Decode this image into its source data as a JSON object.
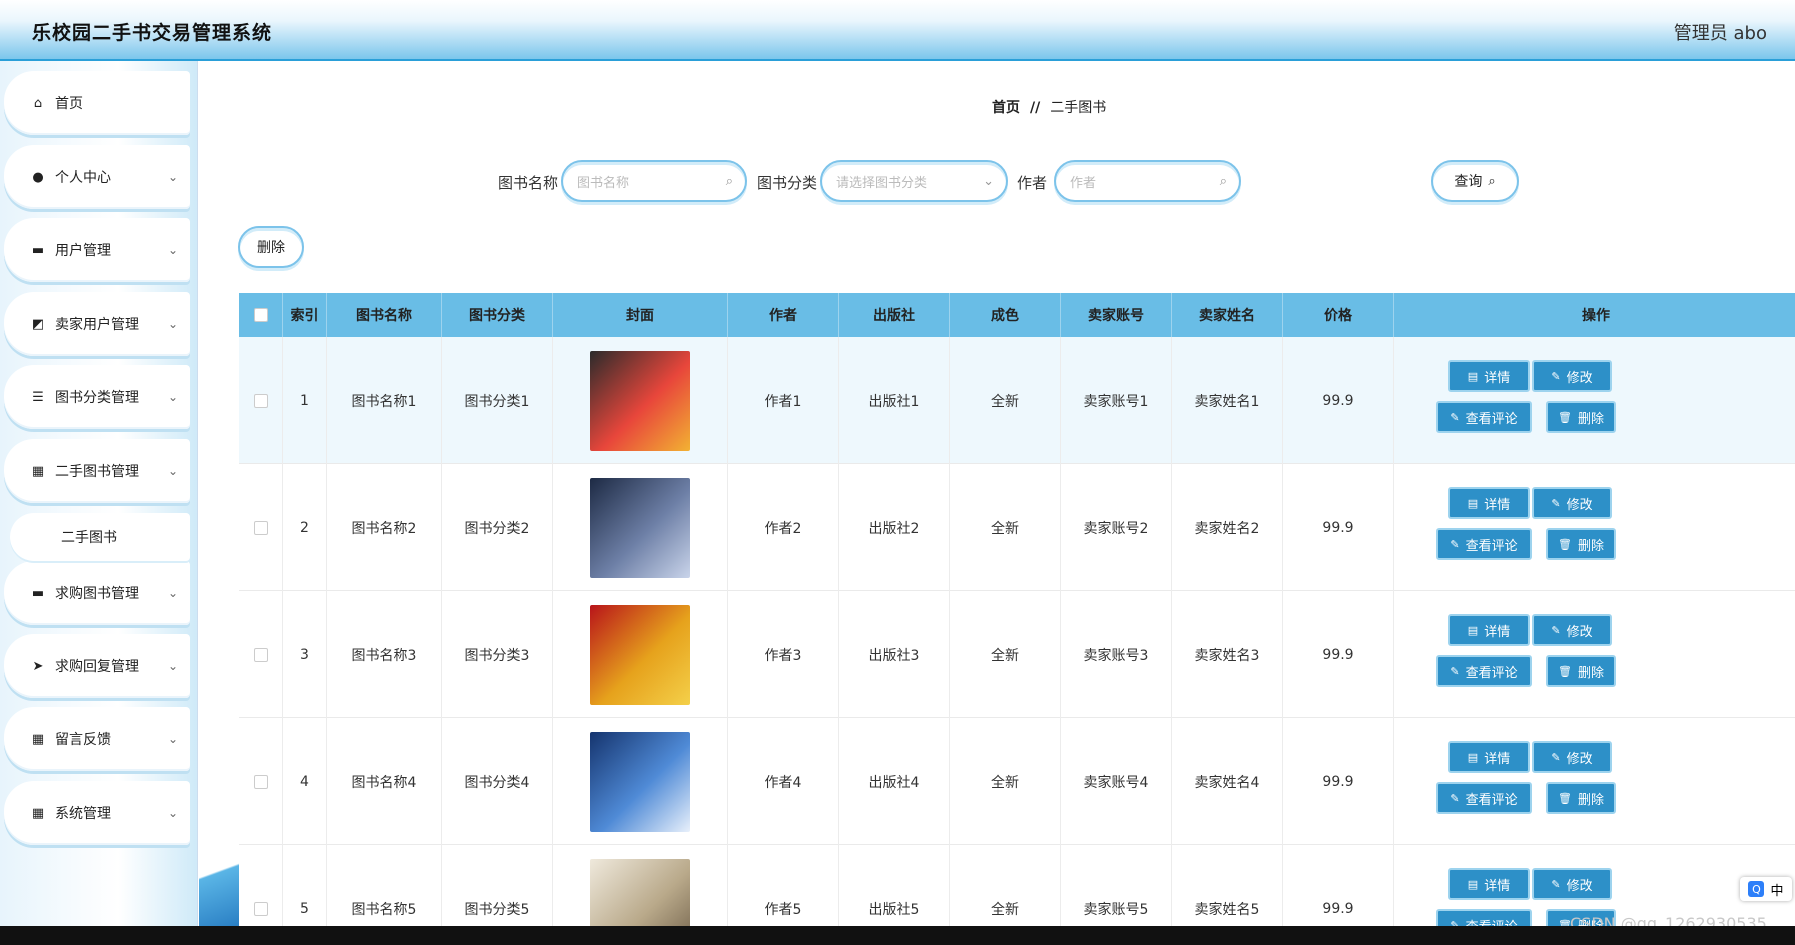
{
  "header": {
    "title": "乐校园二手书交易管理系统",
    "admin": "管理员 abo"
  },
  "sidebar": {
    "items": [
      {
        "label": "首页",
        "icon": "home-icon",
        "glyph": "⌂",
        "has_children": false
      },
      {
        "label": "个人中心",
        "icon": "user-icon",
        "glyph": "●",
        "has_children": true
      },
      {
        "label": "用户管理",
        "icon": "monitor-icon",
        "glyph": "▬",
        "has_children": true
      },
      {
        "label": "卖家用户管理",
        "icon": "chart-icon",
        "glyph": "◩",
        "has_children": true
      },
      {
        "label": "图书分类管理",
        "icon": "list-icon",
        "glyph": "☰",
        "has_children": true
      },
      {
        "label": "二手图书管理",
        "icon": "grid-icon",
        "glyph": "▦",
        "has_children": true
      },
      {
        "label": "求购图书管理",
        "icon": "book-icon",
        "glyph": "▬",
        "has_children": true
      },
      {
        "label": "求购回复管理",
        "icon": "send-icon",
        "glyph": "➤",
        "has_children": true
      },
      {
        "label": "留言反馈",
        "icon": "grid-icon",
        "glyph": "▦",
        "has_children": true
      },
      {
        "label": "系统管理",
        "icon": "grid-icon",
        "glyph": "▦",
        "has_children": true
      }
    ],
    "submenu": {
      "label": "二手图书"
    }
  },
  "breadcrumb": {
    "home": "首页",
    "sep": "//",
    "current": "二手图书"
  },
  "search": {
    "name_label": "图书名称",
    "name_placeholder": "图书名称",
    "category_label": "图书分类",
    "category_placeholder": "请选择图书分类",
    "author_label": "作者",
    "author_placeholder": "作者",
    "query_label": "查询"
  },
  "toolbar": {
    "delete_label": "删除"
  },
  "table": {
    "headers": [
      "索引",
      "图书名称",
      "图书分类",
      "封面",
      "作者",
      "出版社",
      "成色",
      "卖家账号",
      "卖家姓名",
      "价格",
      "操作"
    ],
    "actions": {
      "detail": "详情",
      "edit": "修改",
      "comments": "查看评论",
      "delete": "删除"
    },
    "rows": [
      {
        "index": "1",
        "name": "图书名称1",
        "category": "图书分类1",
        "author": "作者1",
        "publisher": "出版社1",
        "condition": "全新",
        "seller_account": "卖家账号1",
        "seller_name": "卖家姓名1",
        "price": "99.9",
        "cover_colors": [
          "#2b2b2b",
          "#e8463b",
          "#f2b233"
        ]
      },
      {
        "index": "2",
        "name": "图书名称2",
        "category": "图书分类2",
        "author": "作者2",
        "publisher": "出版社2",
        "condition": "全新",
        "seller_account": "卖家账号2",
        "seller_name": "卖家姓名2",
        "price": "99.9",
        "cover_colors": [
          "#1d2a44",
          "#6d7fa6",
          "#c9d4ea"
        ]
      },
      {
        "index": "3",
        "name": "图书名称3",
        "category": "图书分类3",
        "author": "作者3",
        "publisher": "出版社3",
        "condition": "全新",
        "seller_account": "卖家账号3",
        "seller_name": "卖家姓名3",
        "price": "99.9",
        "cover_colors": [
          "#b8141a",
          "#e6a21c",
          "#f4d04a"
        ]
      },
      {
        "index": "4",
        "name": "图书名称4",
        "category": "图书分类4",
        "author": "作者4",
        "publisher": "出版社4",
        "condition": "全新",
        "seller_account": "卖家账号4",
        "seller_name": "卖家姓名4",
        "price": "99.9",
        "cover_colors": [
          "#15346e",
          "#4f8ad6",
          "#e8f0fb"
        ]
      },
      {
        "index": "5",
        "name": "图书名称5",
        "category": "图书分类5",
        "author": "作者5",
        "publisher": "出版社5",
        "condition": "全新",
        "seller_account": "卖家账号5",
        "seller_name": "卖家姓名5",
        "price": "99.9",
        "cover_colors": [
          "#efe9dc",
          "#b9a98a",
          "#6b5b45"
        ]
      }
    ]
  },
  "overlay": {
    "watermark": "CSDN @qq_1262930535",
    "ime_label": "中",
    "ime_q": "Q"
  },
  "colors": {
    "accent": "#2d90c8",
    "header_bg": "#69bde6"
  }
}
